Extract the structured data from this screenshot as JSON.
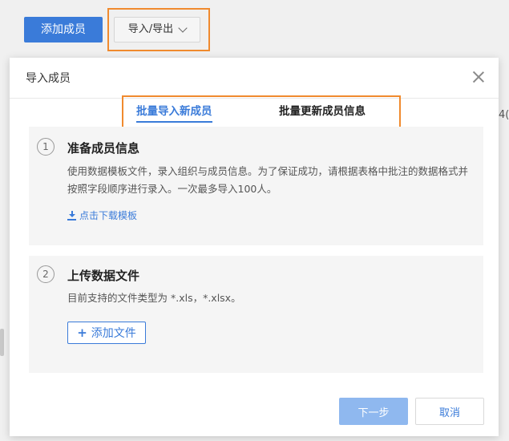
{
  "toolbar": {
    "add_member_label": "添加成员",
    "import_export_label": "导入/导出"
  },
  "background": {
    "right_fragment": "4("
  },
  "modal": {
    "title": "导入成员",
    "tabs": [
      {
        "label": "批量导入新成员",
        "active": true
      },
      {
        "label": "批量更新成员信息",
        "active": false
      }
    ],
    "step1": {
      "number": "1",
      "title": "准备成员信息",
      "description": "使用数据模板文件，录入组织与成员信息。为了保证成功，请根据表格中批注的数据格式并按照字段顺序进行录入。一次最多导入100人。",
      "download_label": "点击下载模板"
    },
    "step2": {
      "number": "2",
      "title": "上传数据文件",
      "description": "目前支持的文件类型为 *.xls，*.xlsx。",
      "add_file_label": "添加文件"
    },
    "footer": {
      "next_label": "下一步",
      "cancel_label": "取消"
    }
  },
  "colors": {
    "primary": "#3a7bd9",
    "primary_disabled": "#8fb8ef",
    "highlight": "#f08a2e"
  }
}
